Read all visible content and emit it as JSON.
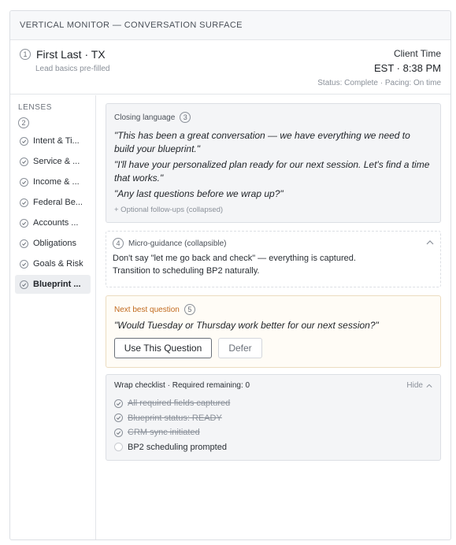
{
  "header": {
    "title": "VERTICAL MONITOR — CONVERSATION SURFACE"
  },
  "lead": {
    "step": "1",
    "name": "First Last · TX",
    "subtitle": "Lead basics pre-filled",
    "client_time_label": "Client Time",
    "client_time_value": "EST · 8:38 PM",
    "status": "Status: Complete · Pacing: On time"
  },
  "sidebar": {
    "title": "LENSES",
    "step": "2",
    "items": [
      {
        "label": "Intent & Ti...",
        "active": false
      },
      {
        "label": "Service & ...",
        "active": false
      },
      {
        "label": "Income & ...",
        "active": false
      },
      {
        "label": "Federal Be...",
        "active": false
      },
      {
        "label": "Accounts ...",
        "active": false
      },
      {
        "label": "Obligations",
        "active": false
      },
      {
        "label": "Goals & Risk",
        "active": false
      },
      {
        "label": "Blueprint ...",
        "active": true
      }
    ]
  },
  "closing": {
    "label": "Closing language",
    "step": "3",
    "quotes": [
      "\"This has been a great conversation — we have everything we need to build your blueprint.\"",
      "\"I'll have your personalized plan ready for our next session. Let's find a time that works.\"",
      "\"Any last questions before we wrap up?\""
    ],
    "followups": "+ Optional follow-ups (collapsed)"
  },
  "micro": {
    "step": "4",
    "label": "Micro-guidance (collapsible)",
    "lines": [
      "Don't say \"let me go back and check\" — everything is captured.",
      "Transition to scheduling BP2 naturally."
    ]
  },
  "nbq": {
    "label": "Next best question",
    "step": "5",
    "question": "\"Would Tuesday or Thursday work better for our next session?\"",
    "use_button": "Use This Question",
    "defer_button": "Defer"
  },
  "wrap": {
    "title": "Wrap checklist · Required remaining: 0",
    "hide_label": "Hide",
    "items": [
      {
        "label": "All required fields captured",
        "done": true
      },
      {
        "label": "Blueprint status: READY",
        "done": true
      },
      {
        "label": "CRM sync initiated",
        "done": true
      },
      {
        "label": "BP2 scheduling prompted",
        "done": false
      }
    ]
  },
  "colors": {
    "accent_orange": "#c26a1e",
    "panel_gray": "#f4f5f7",
    "nbq_bg": "#fffcf6"
  }
}
